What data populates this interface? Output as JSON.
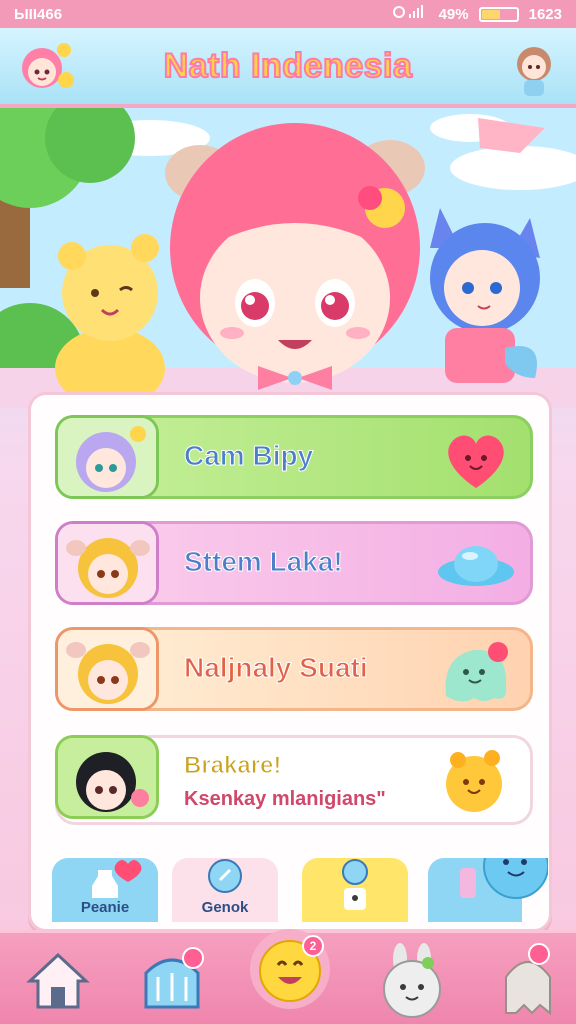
{
  "status_bar": {
    "left_text": "ЫII466",
    "battery_text": "49%",
    "time": "1623",
    "battery_level": 0.55
  },
  "header": {
    "title": "Nath Indenesia"
  },
  "menu": {
    "items": [
      {
        "label": "Cam Bipy",
        "icon": "heart-blob-icon"
      },
      {
        "label": "Sttem Laka!",
        "icon": "saturn-hat-icon"
      },
      {
        "label": "Naljnaly Suati",
        "icon": "ghost-blob-icon"
      },
      {
        "label": "Brakare!",
        "sublabel": "Ksenkay mlanigians\"",
        "icon": "star-blob-icon"
      }
    ]
  },
  "shortcuts": [
    {
      "label": "Peanie",
      "icon": "bottle-icon"
    },
    {
      "label": "Genok",
      "icon": "compass-icon"
    },
    {
      "label": "",
      "icon": "lock-icon"
    },
    {
      "label": "",
      "icon": "gift-icon"
    }
  ],
  "bottom_nav": {
    "items": [
      {
        "icon": "home-icon",
        "badge": ""
      },
      {
        "icon": "hair-icon",
        "badge": ""
      },
      {
        "icon": "smile-icon",
        "badge": "2"
      },
      {
        "icon": "bunny-icon",
        "badge": ""
      },
      {
        "icon": "ghost-icon",
        "badge": ""
      }
    ]
  },
  "colors": {
    "accent_pink": "#f29ab8",
    "title_yellow": "#ffd14a",
    "panel_border": "#f4c7d7"
  }
}
